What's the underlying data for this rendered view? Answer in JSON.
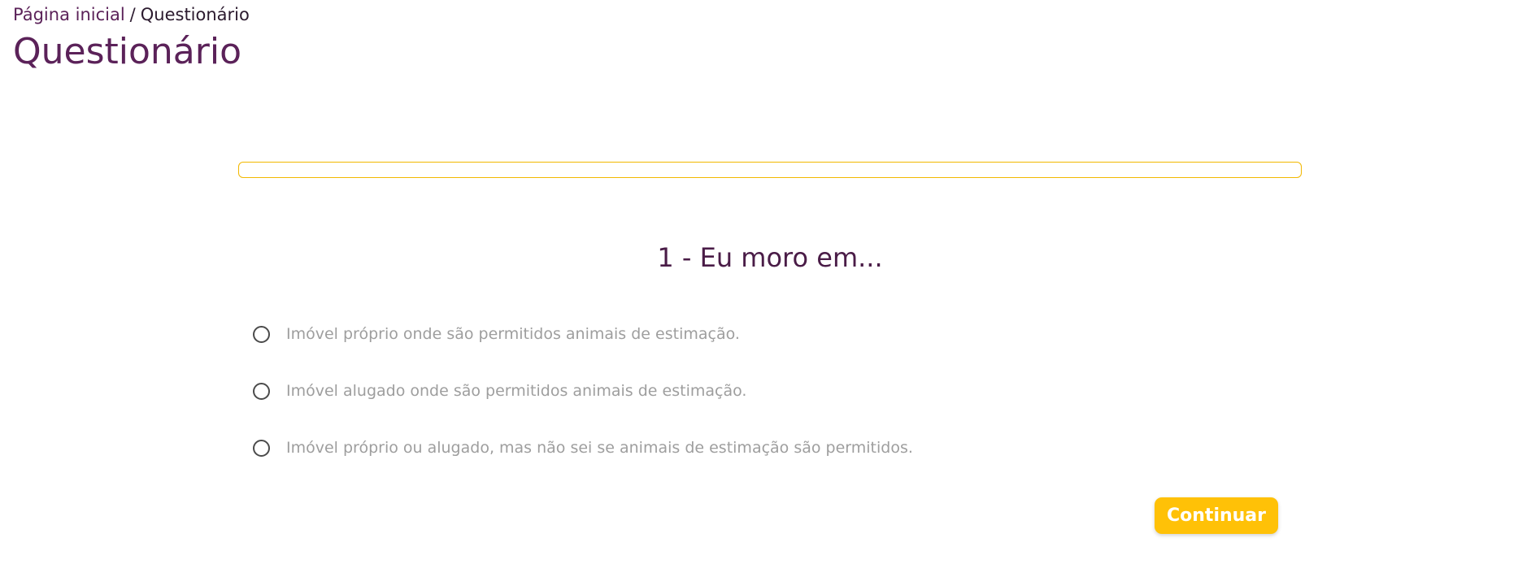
{
  "breadcrumb": {
    "home_label": "Página inicial",
    "separator": "/",
    "current_label": "Questionário"
  },
  "page": {
    "title": "Questionário"
  },
  "progress": {
    "value_percent": 0
  },
  "question": {
    "title": "1 - Eu moro em...",
    "options": [
      {
        "label": "Imóvel próprio onde são permitidos animais de estimação."
      },
      {
        "label": "Imóvel alugado onde são permitidos animais de estimação."
      },
      {
        "label": "Imóvel próprio ou alugado, mas não sei se animais de estimação são permitidos."
      }
    ]
  },
  "actions": {
    "continue_label": "Continuar"
  },
  "colors": {
    "brand_purple": "#5b2259",
    "accent_yellow": "#ffc107",
    "option_text_gray": "#9e9e9e"
  }
}
